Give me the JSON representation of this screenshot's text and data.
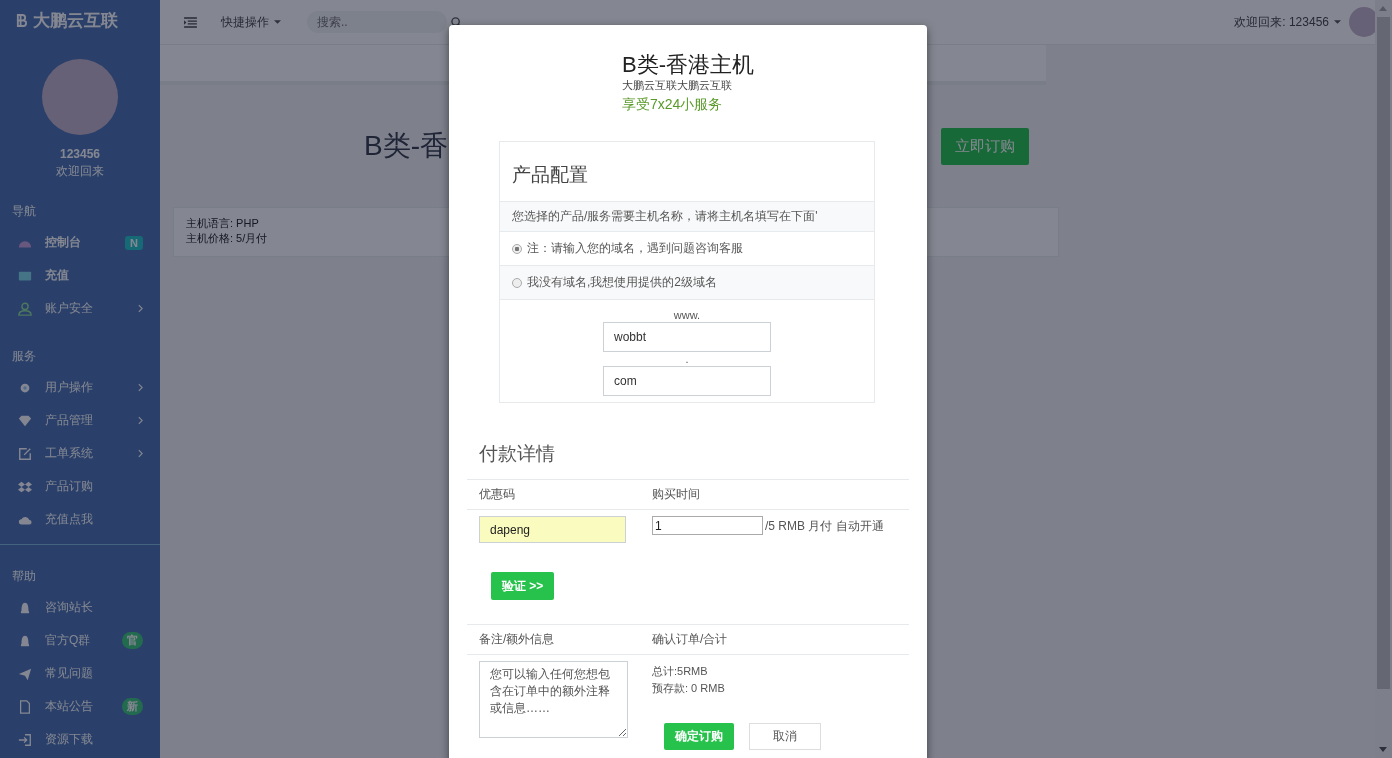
{
  "sidebar": {
    "logo": "大鹏云互联",
    "user": {
      "name": "123456",
      "greeting": "欢迎回来"
    },
    "sections": [
      {
        "title": "导航",
        "items": [
          {
            "label": "控制台",
            "highlighted": true,
            "has_submenu": false,
            "badge": {
              "text": "N",
              "color": "#166a75"
            }
          },
          {
            "label": "充值",
            "highlighted": true,
            "has_submenu": false
          },
          {
            "label": "账户安全",
            "highlighted": false,
            "has_submenu": true
          }
        ]
      },
      {
        "title": "服务",
        "items": [
          {
            "label": "用户操作",
            "highlighted": false,
            "has_submenu": true
          },
          {
            "label": "产品管理",
            "highlighted": false,
            "has_submenu": true
          },
          {
            "label": "工单系统",
            "highlighted": false,
            "has_submenu": true
          },
          {
            "label": "产品订购",
            "highlighted": false,
            "has_submenu": false
          },
          {
            "label": "充值点我",
            "highlighted": false,
            "has_submenu": false
          }
        ]
      },
      {
        "title": "帮助",
        "items": [
          {
            "label": "咨询站长",
            "highlighted": false,
            "has_submenu": false
          },
          {
            "label": "官方Q群",
            "highlighted": false,
            "has_submenu": false,
            "badge": {
              "text": "官",
              "color": "#236b4e"
            }
          },
          {
            "label": "常见问题",
            "highlighted": false,
            "has_submenu": false
          },
          {
            "label": "本站公告",
            "highlighted": false,
            "has_submenu": false,
            "badge": {
              "text": "新",
              "color": "#236b4e"
            }
          },
          {
            "label": "资源下载",
            "highlighted": false,
            "has_submenu": false
          }
        ]
      }
    ]
  },
  "topbar": {
    "quick_menu": "快捷操作",
    "search": {
      "placeholder": "搜索.."
    },
    "welcome": "欢迎回来: 123456"
  },
  "product": {
    "title": "B类-香",
    "order_button": "立即订购",
    "info": [
      "主机语言: PHP",
      "主机价格: 5/月付"
    ]
  },
  "modal": {
    "title": "B类-香港主机",
    "subtitle": "大鹏云互联大鹏云互联",
    "tagline": "享受7x24小服务",
    "config": {
      "heading": "产品配置",
      "notice": "您选择的产品/服务需要主机名称，请将主机名填写在下面'",
      "options": [
        {
          "label": "注：请输入您的域名，遇到问题咨询客服",
          "selected": true
        },
        {
          "label": "我没有域名,我想使用提供的2级域名",
          "selected": false
        }
      ],
      "prefix": "www.",
      "hostname": "wobbt",
      "separator": ".",
      "suffix": "com"
    },
    "payment": {
      "heading": "付款详情",
      "coupon_label": "优惠码",
      "period_label": "购买时间",
      "coupon": "dapeng",
      "period": "1",
      "price_note": "/5 RMB 月付 自动开通",
      "verify_button": "验证 >>",
      "notes_label": "备注/额外信息",
      "confirm_label": "确认订单/合计",
      "notes_placeholder": "您可以输入任何您想包含在订单中的额外注释或信息……",
      "total": "总计:5RMB",
      "deposit": "预存款: 0 RMB",
      "submit_button": "确定订购",
      "cancel_button": "取消"
    }
  }
}
